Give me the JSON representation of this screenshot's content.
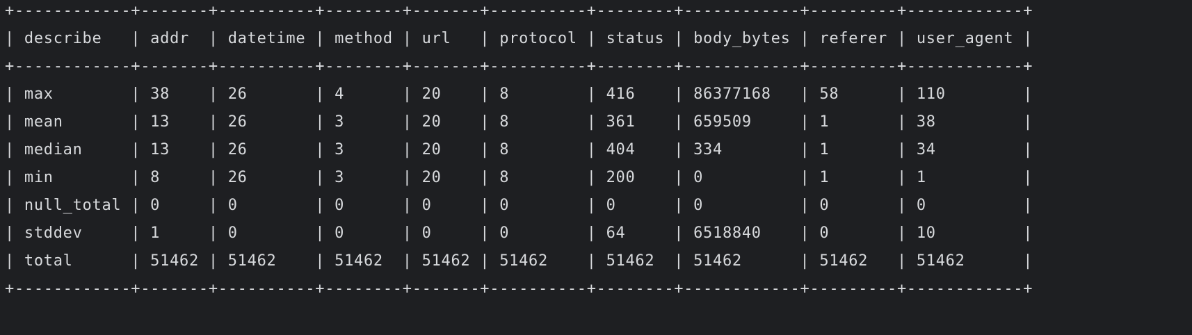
{
  "terminal": {
    "columns": [
      "describe",
      "addr",
      "datetime",
      "method",
      "url",
      "protocol",
      "status",
      "body_bytes",
      "referer",
      "user_agent"
    ],
    "rows": [
      [
        "max",
        "38",
        "26",
        "4",
        "20",
        "8",
        "416",
        "86377168",
        "58",
        "110"
      ],
      [
        "mean",
        "13",
        "26",
        "3",
        "20",
        "8",
        "361",
        "659509",
        "1",
        "38"
      ],
      [
        "median",
        "13",
        "26",
        "3",
        "20",
        "8",
        "404",
        "334",
        "1",
        "34"
      ],
      [
        "min",
        "8",
        "26",
        "3",
        "20",
        "8",
        "200",
        "0",
        "1",
        "1"
      ],
      [
        "null_total",
        "0",
        "0",
        "0",
        "0",
        "0",
        "0",
        "0",
        "0",
        "0"
      ],
      [
        "stddev",
        "1",
        "0",
        "0",
        "0",
        "0",
        "64",
        "6518840",
        "0",
        "10"
      ],
      [
        "total",
        "51462",
        "51462",
        "51462",
        "51462",
        "51462",
        "51462",
        "51462",
        "51462",
        "51462"
      ]
    ],
    "lines": {
      "border_top": "+------------+-------+----------+--------+-------+----------+--------+------------+---------+------------+",
      "header": "| describe   | addr  | datetime | method | url   | protocol | status | body_bytes | referer | user_agent |",
      "border_mid": "+------------+-------+----------+--------+-------+----------+--------+------------+---------+------------+",
      "row_0": "| max        | 38    | 26       | 4      | 20    | 8        | 416    | 86377168   | 58      | 110        |",
      "row_1": "| mean       | 13    | 26       | 3      | 20    | 8        | 361    | 659509     | 1       | 38         |",
      "row_2": "| median     | 13    | 26       | 3      | 20    | 8        | 404    | 334        | 1       | 34         |",
      "row_3": "| min        | 8     | 26       | 3      | 20    | 8        | 200    | 0          | 1       | 1          |",
      "row_4": "| null_total | 0     | 0        | 0      | 0     | 0        | 0      | 0          | 0       | 0          |",
      "row_5": "| stddev     | 1     | 0        | 0      | 0     | 0        | 64     | 6518840    | 0       | 10         |",
      "row_6": "| total      | 51462 | 51462    | 51462  | 51462 | 51462    | 51462  | 51462      | 51462   | 51462      |",
      "border_bottom": "+------------+-------+----------+--------+-------+----------+--------+------------+---------+------------+"
    },
    "colors": {
      "background": "#1e1f22",
      "foreground": "#d7d9dc"
    }
  }
}
